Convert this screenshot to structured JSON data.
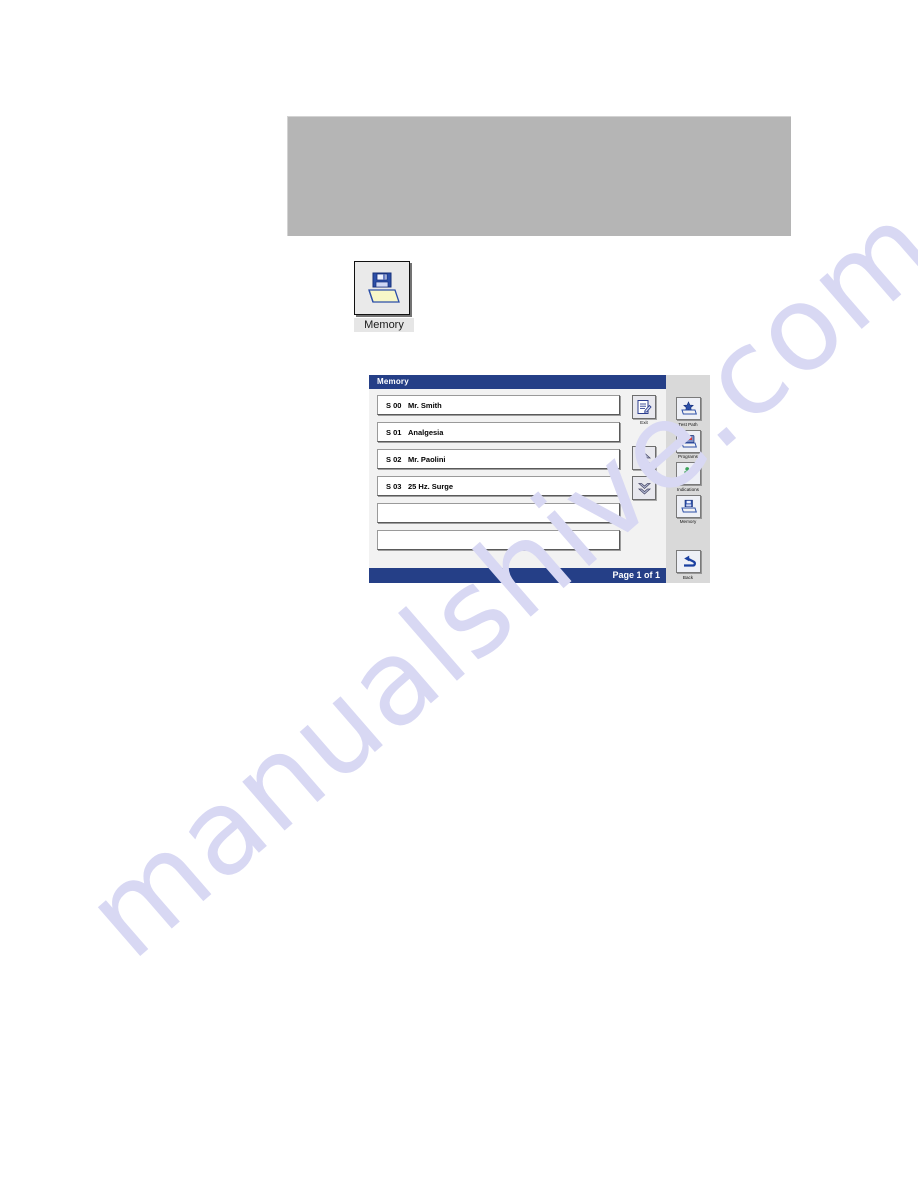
{
  "page": {
    "background_color": "#ffffff",
    "watermark_text": "manualshive.com",
    "watermark_color": "#d8d8f3"
  },
  "figure_placeholder": {
    "name": "empty-gray-figure-box",
    "color": "#b5b5b5"
  },
  "desktop_icon": {
    "label": "Memory",
    "icon": "floppy-disk-over-tray-icon"
  },
  "device_screen": {
    "title": "Memory",
    "status": "Page 1 of 1",
    "title_bar_color": "#253f87",
    "slots": [
      {
        "id": "S 00",
        "label": "Mr. Smith"
      },
      {
        "id": "S 01",
        "label": "Analgesia"
      },
      {
        "id": "S 02",
        "label": "Mr. Paolini"
      },
      {
        "id": "S 03",
        "label": "25 Hz. Surge"
      },
      {
        "id": "",
        "label": ""
      },
      {
        "id": "",
        "label": ""
      }
    ],
    "mid_buttons": [
      {
        "name": "exit-button",
        "label": "Exit",
        "icon": "document-edit-icon"
      },
      {
        "name": "scroll-up-button",
        "label": "",
        "icon": "double-chevron-up-icon"
      },
      {
        "name": "scroll-down-button",
        "label": "",
        "icon": "double-chevron-down-icon"
      }
    ],
    "side_buttons": [
      {
        "name": "test-path-button",
        "label": "Test Path",
        "icon": "star-tray-icon"
      },
      {
        "name": "programs-button",
        "label": "Programs",
        "icon": "programs-tray-icon"
      },
      {
        "name": "indications-button",
        "label": "Indications",
        "icon": "body-figure-icon"
      },
      {
        "name": "memory-button",
        "label": "Memory",
        "icon": "floppy-disk-over-tray-icon"
      },
      {
        "name": "back-button",
        "label": "Back",
        "icon": "curved-back-arrow-icon"
      }
    ]
  }
}
